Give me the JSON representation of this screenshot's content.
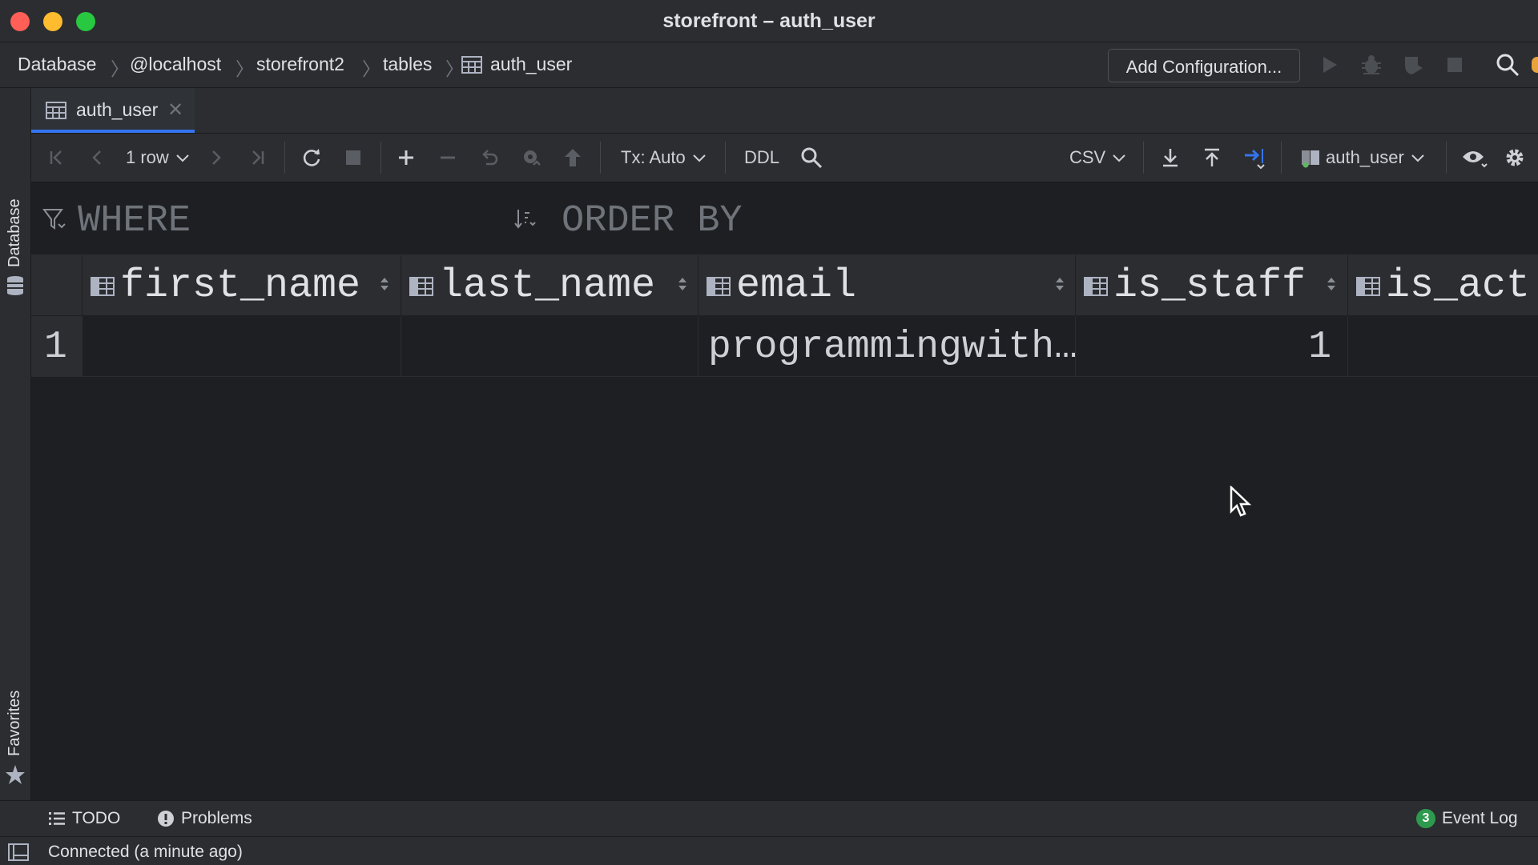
{
  "window": {
    "title": "storefront – auth_user"
  },
  "breadcrumb": [
    "Database",
    "@localhost",
    "storefront2",
    "tables",
    "auth_user"
  ],
  "navbar": {
    "add_config_label": "Add Configuration..."
  },
  "side": {
    "database_label": "Database",
    "favorites_label": "Favorites"
  },
  "tab": {
    "label": "auth_user"
  },
  "toolbar": {
    "rows_label": "1 row",
    "tx_label": "Tx: Auto",
    "ddl_label": "DDL",
    "export_format": "CSV",
    "table_selector": "auth_user"
  },
  "filter": {
    "where_label": "WHERE",
    "order_label": "ORDER BY"
  },
  "grid": {
    "columns": [
      "first_name",
      "last_name",
      "email",
      "is_staff",
      "is_act"
    ],
    "rows": [
      {
        "num": "1",
        "first_name": "",
        "last_name": "",
        "email": "programmingwith…",
        "is_staff": "1",
        "is_act": ""
      }
    ]
  },
  "bottom": {
    "todo": "TODO",
    "problems": "Problems",
    "event_count": "3",
    "event_log": "Event Log"
  },
  "status": {
    "text": "Connected (a minute ago)"
  },
  "colors": {
    "accent": "#3574f0",
    "bg": "#1e1f22",
    "panel": "#2b2d30"
  }
}
